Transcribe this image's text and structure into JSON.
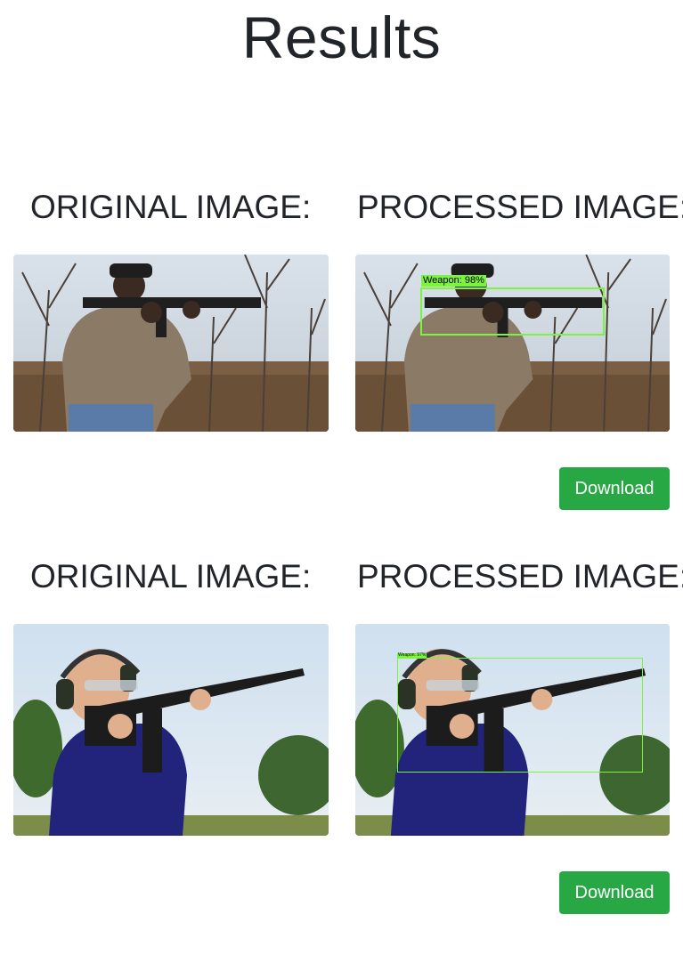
{
  "page": {
    "title": "Results"
  },
  "results": [
    {
      "original_heading": "ORIGINAL IMAGE:",
      "processed_heading": "PROCESSED IMAGE:",
      "detection_label": "Weapon: 98%",
      "download_label": "Download"
    },
    {
      "original_heading": "ORIGINAL IMAGE:",
      "processed_heading": "PROCESSED IMAGE:",
      "detection_label": "Weapon: 97%",
      "download_label": "Download"
    }
  ],
  "colors": {
    "button": "#28a745",
    "detection_box": "#7cf33d"
  }
}
